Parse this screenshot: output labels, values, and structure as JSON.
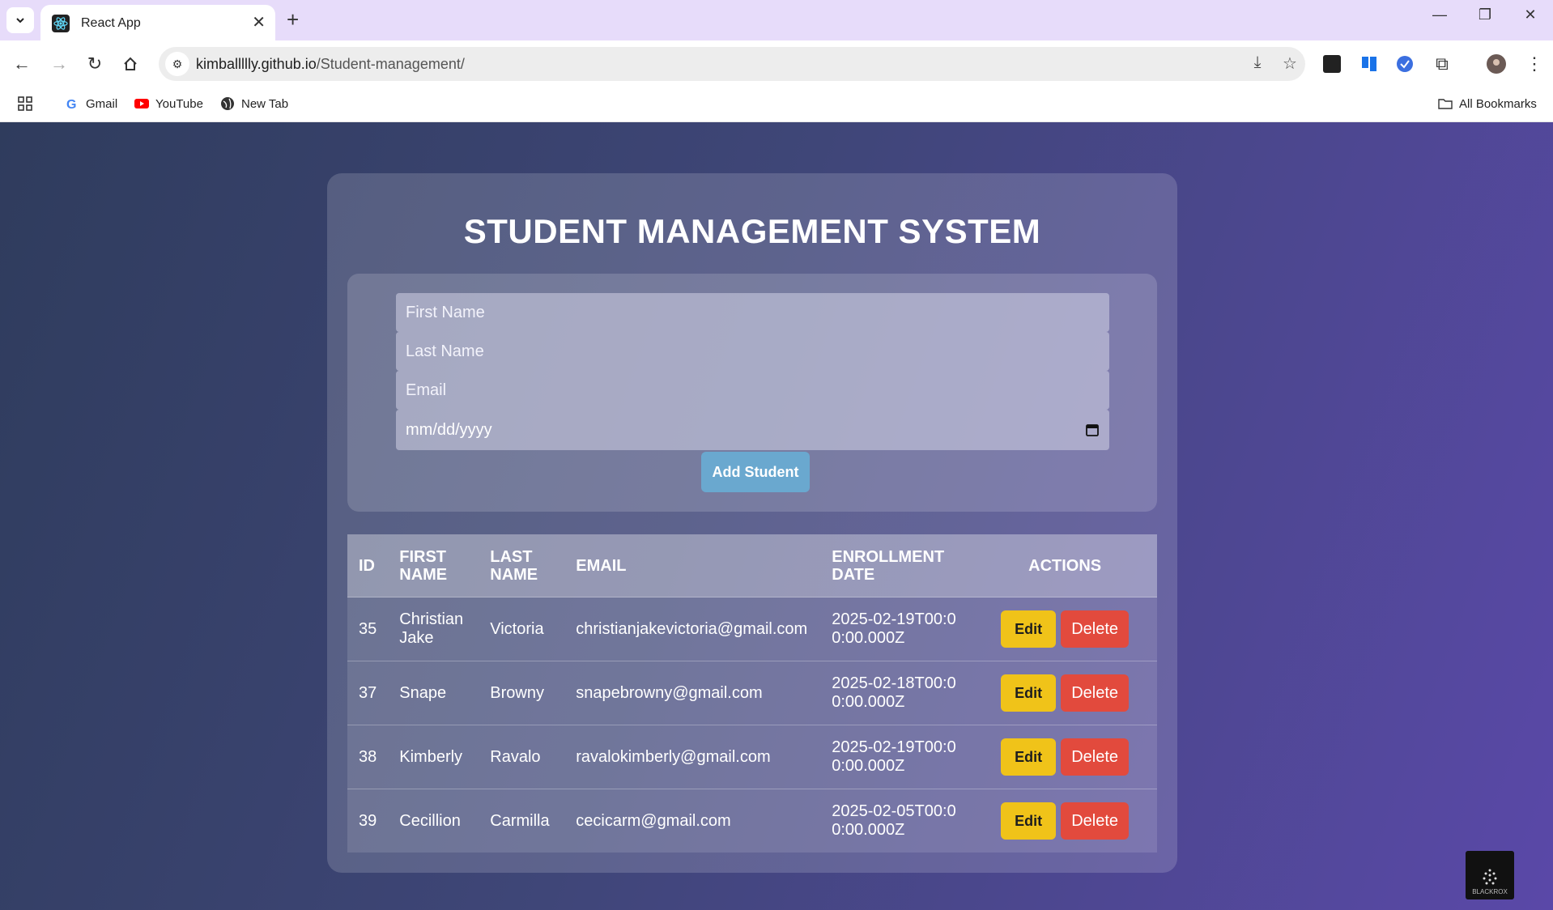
{
  "browser": {
    "tab_title": "React App",
    "url_host": "kimballllly.github.io",
    "url_path": "/Student-management/",
    "bookmarks": [
      {
        "label": "Gmail",
        "icon": "google-icon"
      },
      {
        "label": "YouTube",
        "icon": "youtube-icon"
      },
      {
        "label": "New Tab",
        "icon": "globe-icon"
      }
    ],
    "all_bookmarks_label": "All Bookmarks"
  },
  "app": {
    "title": "STUDENT MANAGEMENT SYSTEM",
    "form": {
      "first_name_placeholder": "First Name",
      "last_name_placeholder": "Last Name",
      "email_placeholder": "Email",
      "date_placeholder": "mm/dd/yyyy",
      "add_button": "Add Student"
    },
    "table": {
      "headers": [
        "ID",
        "FIRST NAME",
        "LAST NAME",
        "EMAIL",
        "ENROLLMENT DATE",
        "ACTIONS"
      ],
      "edit_label": "Edit",
      "delete_label": "Delete",
      "rows": [
        {
          "id": "35",
          "first": "Christian Jake",
          "last": "Victoria",
          "email": "christianjakevictoria@gmail.com",
          "date": "2025-02-19T00:00:00.000Z"
        },
        {
          "id": "37",
          "first": "Snape",
          "last": "Browny",
          "email": "snapebrowny@gmail.com",
          "date": "2025-02-18T00:00:00.000Z"
        },
        {
          "id": "38",
          "first": "Kimberly",
          "last": "Ravalo",
          "email": "ravalokimberly@gmail.com",
          "date": "2025-02-19T00:00:00.000Z"
        },
        {
          "id": "39",
          "first": "Cecillion",
          "last": "Carmilla",
          "email": "cecicarm@gmail.com",
          "date": "2025-02-05T00:00:00.000Z"
        }
      ]
    }
  },
  "watermark": "BLACKROX",
  "colors": {
    "edit": "#f0c319",
    "delete": "#e24a3d",
    "add": "#6aa8cf",
    "tabbar": "#e7dcfa"
  }
}
